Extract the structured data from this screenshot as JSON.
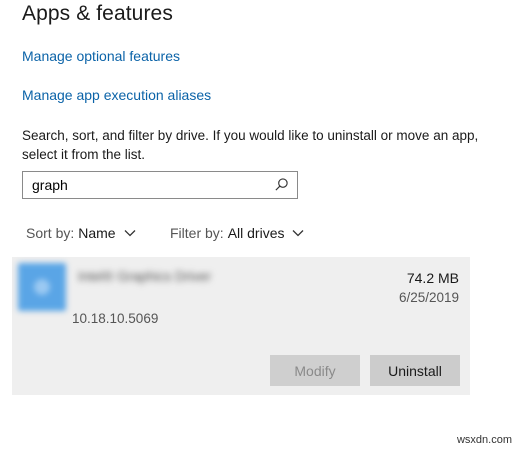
{
  "header": {
    "title": "Apps & features"
  },
  "links": {
    "optional_features": "Manage optional features",
    "execution_aliases": "Manage app execution aliases"
  },
  "description": "Search, sort, and filter by drive. If you would like to uninstall or move an app, select it from the list.",
  "search": {
    "value": "graph",
    "icon": "search-icon"
  },
  "sort": {
    "label": "Sort by:",
    "value": "Name"
  },
  "filter": {
    "label": "Filter by:",
    "value": "All drives"
  },
  "apps": [
    {
      "name": "Intel® Graphics Driver",
      "size": "74.2 MB",
      "date": "6/25/2019",
      "version": "10.18.10.5069",
      "modify_label": "Modify",
      "modify_enabled": false,
      "uninstall_label": "Uninstall"
    }
  ],
  "colors": {
    "link": "#0b63a8",
    "selected_item_bg": "#efefef",
    "button_bg": "#cccccc",
    "disabled_text": "#8a8a8a"
  },
  "watermark": "wsxdn.com"
}
